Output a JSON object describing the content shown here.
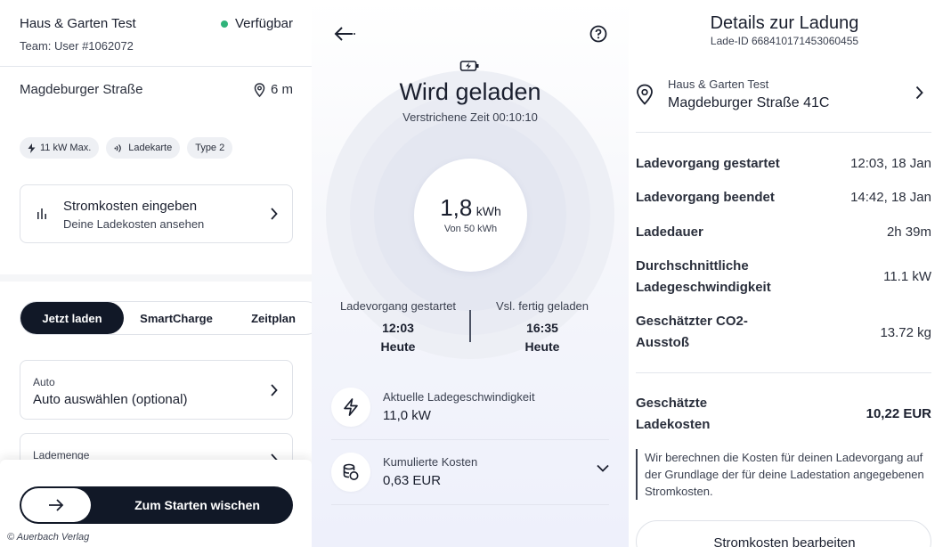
{
  "panel1": {
    "station_name": "Haus & Garten Test",
    "team": "Team: User #1062072",
    "status": "Verfügbar",
    "status_color": "#2fb37a",
    "address": "Magdeburger Straße",
    "distance": "6 m",
    "chips": [
      {
        "icon": "bolt-icon",
        "label": "11 kW Max."
      },
      {
        "icon": "nfc-icon",
        "label": "Ladekarte"
      },
      {
        "icon": "",
        "label": "Type 2"
      }
    ],
    "cost_card": {
      "title": "Stromkosten eingeben",
      "subtitle": "Deine Ladekosten ansehen"
    },
    "tabs": [
      "Jetzt laden",
      "SmartCharge",
      "Zeitplan"
    ],
    "active_tab": "Jetzt laden",
    "auto_card": {
      "label": "Auto",
      "value": "Auto auswählen (optional)"
    },
    "menge_card": {
      "label": "Lademenge"
    },
    "slider_label": "Zum Starten wischen",
    "copyright": "© Auerbach Verlag"
  },
  "panel2": {
    "title": "Wird geladen",
    "elapsed": "Verstrichene Zeit 00:10:10",
    "energy_value": "1,8",
    "energy_unit": "kWh",
    "energy_of": "Von 50 kWh",
    "started_label": "Ladevorgang gestartet",
    "started_time": "12:03",
    "started_day": "Heute",
    "finish_label": "Vsl. fertig geladen",
    "finish_time": "16:35",
    "finish_day": "Heute",
    "speed_label": "Aktuelle Ladegeschwindigkeit",
    "speed_value": "11,0 kW",
    "cost_label": "Kumulierte Kosten",
    "cost_value": "0,63 EUR"
  },
  "panel3": {
    "title": "Details zur Ladung",
    "charge_id": "Lade-ID 668410171453060455",
    "location_name": "Haus & Garten Test",
    "location_address": "Magdeburger Straße 41C",
    "rows": [
      {
        "key": "Ladevorgang gestartet",
        "value": "12:03, 18 Jan"
      },
      {
        "key": "Ladevorgang beendet",
        "value": "14:42, 18 Jan"
      },
      {
        "key": "Ladedauer",
        "value": "2h 39m"
      },
      {
        "key_line1": "Durchschnittliche",
        "key_line2": "Ladegeschwindigkeit",
        "value": "11.1 kW"
      },
      {
        "key_line1": "Geschätzter CO2-",
        "key_line2": "Ausstoß",
        "value": "13.72 kg"
      }
    ],
    "estimated_cost_line1": "Geschätzte",
    "estimated_cost_line2": "Ladekosten",
    "estimated_cost_value": "10,22 EUR",
    "note": "Wir berechnen die Kosten für deinen Ladevorgang auf der Grundlage der für deine Ladestation angegebenen Stromkosten.",
    "edit_button": "Stromkosten bearbeiten"
  }
}
